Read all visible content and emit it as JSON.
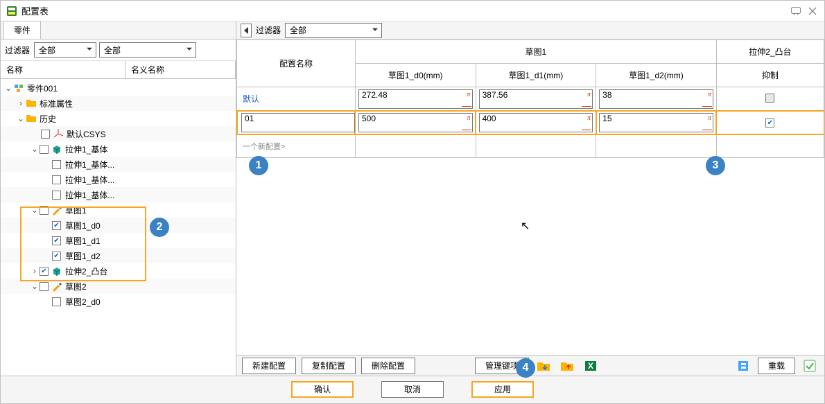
{
  "window": {
    "title": "配置表"
  },
  "left": {
    "tab": "零件",
    "filter_label": "过滤器",
    "filter1": "全部",
    "filter2": "全部",
    "header_name": "名称",
    "header_nominal": "名义名称",
    "tree": {
      "root": "零件001",
      "std_attr": "标准属性",
      "history": "历史",
      "default_csys": "默认CSYS",
      "extrude1": "拉伸1_基体",
      "extrude1_a": "拉伸1_基体...",
      "extrude1_b": "拉伸1_基体...",
      "extrude1_c": "拉伸1_基体...",
      "sketch1": "草图1",
      "sketch1_d0": "草图1_d0",
      "sketch1_d1": "草图1_d1",
      "sketch1_d2": "草图1_d2",
      "extrude2": "拉伸2_凸台",
      "sketch2": "草图2",
      "sketch2_d0": "草图2_d0"
    }
  },
  "right": {
    "filter_label": "过滤器",
    "filter_value": "全部",
    "headers": {
      "config_name": "配置名称",
      "sketch1_group": "草图1",
      "extrude2_group": "拉伸2_凸台",
      "d0": "草图1_d0(mm)",
      "d1": "草图1_d1(mm)",
      "d2": "草图1_d2(mm)",
      "suppress": "抑制"
    },
    "rows": [
      {
        "name": "默认",
        "d0": "272.48",
        "d1": "387.56",
        "d2": "38",
        "suppress": false
      },
      {
        "name": "01",
        "d0": "500",
        "d1": "400",
        "d2": "15",
        "suppress": true
      }
    ],
    "new_config_placeholder": "一个新配置>",
    "buttons": {
      "new": "新建配置",
      "copy": "复制配置",
      "delete": "删除配置",
      "manage": "管理键项",
      "reload": "重载"
    }
  },
  "footer": {
    "ok": "确认",
    "cancel": "取消",
    "apply": "应用"
  },
  "callouts": {
    "c1": "1",
    "c2": "2",
    "c3": "3",
    "c4": "4"
  }
}
